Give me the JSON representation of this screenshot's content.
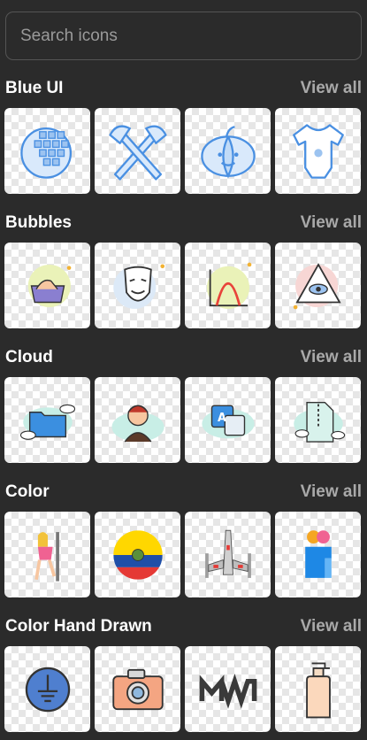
{
  "search": {
    "placeholder": "Search icons"
  },
  "view_all_label": "View all",
  "sections": [
    {
      "title": "Blue UI",
      "icons": [
        "blockchain-globe-icon",
        "crossed-axes-icon",
        "pumpkin-icon",
        "baby-onesie-icon"
      ]
    },
    {
      "title": "Bubbles",
      "icons": [
        "hand-washing-icon",
        "anonymous-mask-icon",
        "bell-curve-chart-icon",
        "eye-pyramid-icon"
      ]
    },
    {
      "title": "Cloud",
      "icons": [
        "folder-cloud-icon",
        "woman-avatar-cloud-icon",
        "translate-cloud-icon",
        "zip-file-cloud-icon"
      ]
    },
    {
      "title": "Color",
      "icons": [
        "pole-dancer-icon",
        "ecuador-flag-icon",
        "x-wing-starfighter-icon",
        "user-profile-icon"
      ]
    },
    {
      "title": "Color Hand Drawn",
      "icons": [
        "earth-ground-symbol-icon",
        "camera-icon",
        "modern-warfare-logo-icon",
        "lotion-bottle-icon"
      ]
    }
  ],
  "colors": {
    "background": "#2b2b2b",
    "muted_text": "#a9a9a9",
    "blue_ui": "#4a90e2",
    "blue_fill": "#d9e9fb"
  }
}
